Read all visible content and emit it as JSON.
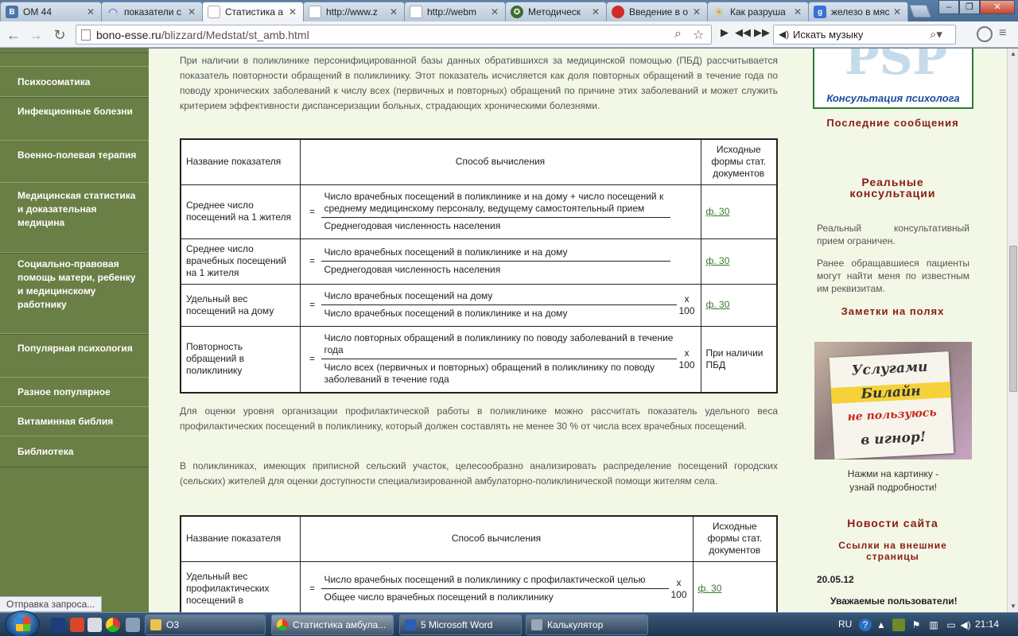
{
  "browser": {
    "tabs": [
      {
        "label": "ОМ 44",
        "icon": "vk-icon",
        "color": "#4a76a8",
        "glyph": "В"
      },
      {
        "label": "показатели с",
        "icon": "loading-spinner-icon",
        "color": "#2b5fb3",
        "glyph": "◠"
      },
      {
        "label": "Статистика а",
        "icon": "page-icon",
        "color": "#ffffff",
        "glyph": ""
      },
      {
        "label": "http://www.z",
        "icon": "page-icon",
        "color": "#ffffff",
        "glyph": ""
      },
      {
        "label": "http://webm",
        "icon": "page-icon",
        "color": "#ffffff",
        "glyph": ""
      },
      {
        "label": "Методическ",
        "icon": "emblem-icon",
        "color": "#3d6b2c",
        "glyph": "✪"
      },
      {
        "label": "Введение в о",
        "icon": "red-globe-icon",
        "color": "#d22a2a",
        "glyph": "●"
      },
      {
        "label": "Как разруша",
        "icon": "sun-icon",
        "color": "#f0a020",
        "glyph": "☀"
      },
      {
        "label": "железо в мяс",
        "icon": "google-icon",
        "color": "#3b6fd8",
        "glyph": "g"
      }
    ],
    "url_domain": "bono-esse.ru",
    "url_path": "/blizzard/Medstat/st_amb.html",
    "music_search_label": "Искать музыку",
    "status_text": "Отправка запроса..."
  },
  "sidebar": {
    "items": [
      {
        "label": "Психосоматика"
      },
      {
        "label": "Инфекционные болезни"
      },
      {
        "label": "Военно-полевая терапия"
      },
      {
        "label": "Медицинская статистика и доказательная медицина"
      },
      {
        "label": "Социально-правовая помощь матери, ребенку и медицинскому работнику"
      },
      {
        "label": "Популярная психология"
      },
      {
        "label": "Разное популярное"
      },
      {
        "label": "Витаминная библия"
      },
      {
        "label": "Библиотека"
      }
    ]
  },
  "content": {
    "intro": "При наличии в поликлинике персонифицированной базы данных обратившихся за медицинской помощью (ПБД) рассчитывается показатель повторности обращений в поликлинику. Этот показатель исчисляется как доля повторных обращений в течение года по поводу хронических заболеваний к числу всех (первичных и повторных) обращений по причине этих заболеваний и может служить критерием эффективности диспансеризации больных, страдающих хроническими болезнями.",
    "table1": {
      "headers": [
        "Название показателя",
        "Способ вычисления",
        "Исходные формы стат. документов"
      ],
      "rows": [
        {
          "name": "Среднее число посещений на 1 жителя",
          "eq": "=",
          "numerator": "Число врачебных посещений в поликлинике и на дому + число посещений к среднему медицинскому персоналу, ведущему самостоятельный прием",
          "denominator": "Среднегодовая численность населения",
          "mult": "",
          "form": "ф. 30",
          "form_link": true
        },
        {
          "name": "Среднее число врачебных посещений на 1 жителя",
          "eq": "=",
          "numerator": "Число врачебных посещений в поликлинике и на дому",
          "denominator": "Среднегодовая численность населения",
          "mult": "",
          "form": "ф. 30",
          "form_link": true
        },
        {
          "name": "Удельный вес посещений на дому",
          "eq": "=",
          "numerator": "Число врачебных посещений на дому",
          "denominator": "Число врачебных посещений в поликлинике и на дому",
          "mult": "х 100",
          "form": "ф. 30",
          "form_link": true
        },
        {
          "name": "Повторность обращений в поликлинику",
          "eq": "=",
          "numerator": "Число повторных обращений в поликлинику по поводу заболеваний в течение года",
          "denominator": "Число всех (первичных и повторных) обращений в поликлинику по поводу заболеваний в течение года",
          "mult": "х 100",
          "form": "При наличии ПБД",
          "form_link": false
        }
      ]
    },
    "para2": "Для оценки уровня организации профилактической работы в поликлинике можно рассчитать показатель удельного веса профилактических посещений в поликлинику, который должен составлять не менее 30 % от числа всех врачебных посещений.",
    "para3": "В поликлиниках, имеющих приписной сельский участок, целесообразно анализировать распределение посещений городских (сельских) жителей для оценки доступности специализированной амбулаторно-поликлинической помощи жителям села.",
    "table2": {
      "headers": [
        "Название показателя",
        "Способ вычисления",
        "Исходные формы стат. документов"
      ],
      "rows": [
        {
          "name": "Удельный вес профилактических посещений в",
          "eq": "=",
          "numerator": "Число врачебных посещений в поликлинику с профилактической целью",
          "denominator": "Общее число врачебных посещений в поликлинику",
          "mult": "х 100",
          "form": "ф. 30",
          "form_link": true
        }
      ]
    }
  },
  "rightbar": {
    "psy_caption": "Консультация психолога",
    "psy_logo": "PSP",
    "latest_messages": "Последние сообщения",
    "real_consult": "Реальные консультации",
    "consult_text1": "Реальный консультативный прием ограничен.",
    "consult_text2": "Ранее обращавшиеся пациенты могут найти меня по известным им реквизитам.",
    "margin_notes": "Заметки на полях",
    "ad_lines": [
      "Услугами",
      "Билайн",
      "не пользуюсь",
      "в игнор!"
    ],
    "ad_caption1": "Нажми на картинку -",
    "ad_caption2": "узнай подробности!",
    "site_news": "Новости сайта",
    "external_links": "Ссылки на внешние страницы",
    "news_date": "20.05.12",
    "news_title": "Уважаемые пользователи!"
  },
  "taskbar": {
    "buttons": [
      {
        "label": "О3",
        "icon": "folder-icon",
        "color": "#e8c54a"
      },
      {
        "label": "Статистика амбула...",
        "icon": "chrome-icon",
        "color": "#4caf50"
      },
      {
        "label": "5 Microsoft Word",
        "icon": "word-icon",
        "color": "#2b5fb3"
      },
      {
        "label": "Калькулятор",
        "icon": "calculator-icon",
        "color": "#9aa8b8"
      }
    ],
    "lang": "RU",
    "clock": "21:14"
  }
}
